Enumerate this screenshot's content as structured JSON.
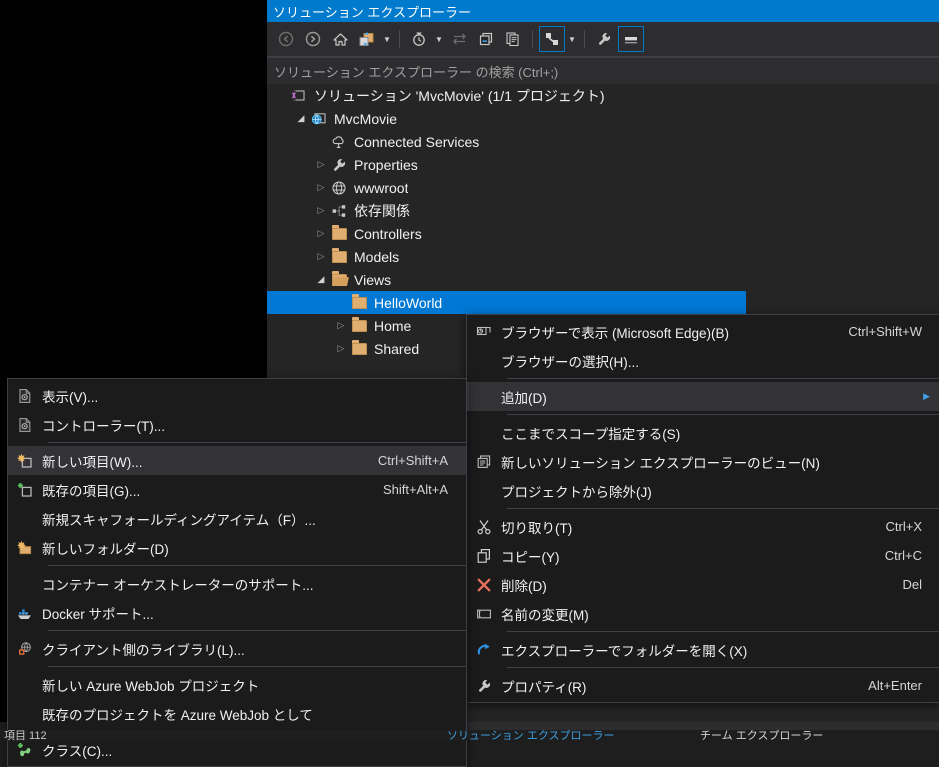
{
  "window": {
    "title": "ソリューション エクスプローラー"
  },
  "toolbar": {
    "buttons": [
      {
        "name": "back-icon",
        "label": "戻る"
      },
      {
        "name": "forward-icon",
        "label": "進む"
      },
      {
        "name": "home-icon",
        "label": "ホーム"
      },
      {
        "name": "pending-changes-icon",
        "label": "保留中の変更"
      },
      {
        "name": "history-icon",
        "label": "履歴"
      },
      {
        "name": "sync-icon",
        "label": "同期"
      },
      {
        "name": "collapse-all-icon",
        "label": "すべて折りたたむ"
      },
      {
        "name": "show-all-files-icon",
        "label": "すべてのファイルを表示"
      },
      {
        "name": "filter-icon",
        "label": "フィルター"
      },
      {
        "name": "properties-wrench-icon",
        "label": "プロパティ"
      },
      {
        "name": "preview-pane-icon",
        "label": "プレビュー"
      }
    ]
  },
  "search": {
    "placeholder": "ソリューション エクスプローラー の検索 (Ctrl+;)"
  },
  "tree": {
    "items": [
      {
        "label": "ソリューション 'MvcMovie' (1/1 プロジェクト)",
        "indent": 0,
        "twisty": "none",
        "icon": "solution-icon",
        "selected": false
      },
      {
        "label": "MvcMovie",
        "indent": 1,
        "twisty": "open",
        "icon": "web-project-icon",
        "selected": false
      },
      {
        "label": "Connected Services",
        "indent": 2,
        "twisty": "none",
        "icon": "connected-services-icon",
        "selected": false
      },
      {
        "label": "Properties",
        "indent": 2,
        "twisty": "closed",
        "icon": "wrench-icon",
        "selected": false
      },
      {
        "label": "wwwroot",
        "indent": 2,
        "twisty": "closed",
        "icon": "globe-icon",
        "selected": false
      },
      {
        "label": "依存関係",
        "indent": 2,
        "twisty": "closed",
        "icon": "dependencies-icon",
        "selected": false
      },
      {
        "label": "Controllers",
        "indent": 2,
        "twisty": "closed",
        "icon": "folder-icon",
        "selected": false
      },
      {
        "label": "Models",
        "indent": 2,
        "twisty": "closed",
        "icon": "folder-icon",
        "selected": false
      },
      {
        "label": "Views",
        "indent": 2,
        "twisty": "open",
        "icon": "folder-open-icon",
        "selected": false
      },
      {
        "label": "HelloWorld",
        "indent": 3,
        "twisty": "none",
        "icon": "folder-icon",
        "selected": true
      },
      {
        "label": "Home",
        "indent": 3,
        "twisty": "closed",
        "icon": "folder-icon",
        "selected": false
      },
      {
        "label": "Shared",
        "indent": 3,
        "twisty": "closed",
        "icon": "folder-icon",
        "selected": false
      }
    ]
  },
  "context_menu": {
    "items": [
      {
        "label": "ブラウザーで表示 (Microsoft Edge)(B)",
        "accel": "Ctrl+Shift+W",
        "icon": "view-in-browser-icon",
        "submenu": false,
        "highlight": false,
        "sep_after": false
      },
      {
        "label": "ブラウザーの選択(H)...",
        "accel": "",
        "icon": "",
        "submenu": false,
        "highlight": false,
        "sep_after": true
      },
      {
        "label": "追加(D)",
        "accel": "",
        "icon": "",
        "submenu": true,
        "highlight": true,
        "sep_after": true
      },
      {
        "label": "ここまでスコープ指定する(S)",
        "accel": "",
        "icon": "",
        "submenu": false,
        "highlight": false,
        "sep_after": false
      },
      {
        "label": "新しいソリューション エクスプローラーのビュー(N)",
        "accel": "",
        "icon": "new-solution-view-icon",
        "submenu": false,
        "highlight": false,
        "sep_after": false
      },
      {
        "label": "プロジェクトから除外(J)",
        "accel": "",
        "icon": "",
        "submenu": false,
        "highlight": false,
        "sep_after": true
      },
      {
        "label": "切り取り(T)",
        "accel": "Ctrl+X",
        "icon": "cut-icon",
        "submenu": false,
        "highlight": false,
        "sep_after": false
      },
      {
        "label": "コピー(Y)",
        "accel": "Ctrl+C",
        "icon": "copy-icon",
        "submenu": false,
        "highlight": false,
        "sep_after": false
      },
      {
        "label": "削除(D)",
        "accel": "Del",
        "icon": "delete-icon",
        "submenu": false,
        "highlight": false,
        "sep_after": false
      },
      {
        "label": "名前の変更(M)",
        "accel": "",
        "icon": "rename-icon",
        "submenu": false,
        "highlight": false,
        "sep_after": true
      },
      {
        "label": "エクスプローラーでフォルダーを開く(X)",
        "accel": "",
        "icon": "open-folder-icon",
        "submenu": false,
        "highlight": false,
        "sep_after": true
      },
      {
        "label": "プロパティ(R)",
        "accel": "Alt+Enter",
        "icon": "properties-icon",
        "submenu": false,
        "highlight": false,
        "sep_after": false
      }
    ]
  },
  "add_submenu": {
    "items": [
      {
        "label": "表示(V)...",
        "accel": "",
        "icon": "view-page-icon",
        "highlight": false,
        "sep_after": false
      },
      {
        "label": "コントローラー(T)...",
        "accel": "",
        "icon": "controller-page-icon",
        "highlight": false,
        "sep_after": true
      },
      {
        "label": "新しい項目(W)...",
        "accel": "Ctrl+Shift+A",
        "icon": "new-item-icon",
        "highlight": true,
        "sep_after": false
      },
      {
        "label": "既存の項目(G)...",
        "accel": "Shift+Alt+A",
        "icon": "existing-item-icon",
        "highlight": false,
        "sep_after": false
      },
      {
        "label": "新規スキャフォールディングアイテム（F）...",
        "accel": "",
        "icon": "",
        "highlight": false,
        "sep_after": false
      },
      {
        "label": "新しいフォルダー(D)",
        "accel": "",
        "icon": "new-folder-icon",
        "highlight": false,
        "sep_after": true
      },
      {
        "label": "コンテナー オーケストレーターのサポート...",
        "accel": "",
        "icon": "",
        "highlight": false,
        "sep_after": false
      },
      {
        "label": "Docker サポート...",
        "accel": "",
        "icon": "docker-icon",
        "highlight": false,
        "sep_after": true
      },
      {
        "label": "クライアント側のライブラリ(L)...",
        "accel": "",
        "icon": "client-library-icon",
        "highlight": false,
        "sep_after": true
      },
      {
        "label": "新しい Azure WebJob プロジェクト",
        "accel": "",
        "icon": "",
        "highlight": false,
        "sep_after": false
      },
      {
        "label": "既存のプロジェクトを Azure WebJob として",
        "accel": "",
        "icon": "",
        "highlight": false,
        "sep_after": true
      },
      {
        "label": "クラス(C)...",
        "accel": "",
        "icon": "class-icon",
        "highlight": false,
        "sep_after": false
      }
    ]
  },
  "statusbar": {
    "left": "項目 112",
    "middle": "ソリューション エクスプローラー",
    "right": "チーム エクスプローラー"
  }
}
